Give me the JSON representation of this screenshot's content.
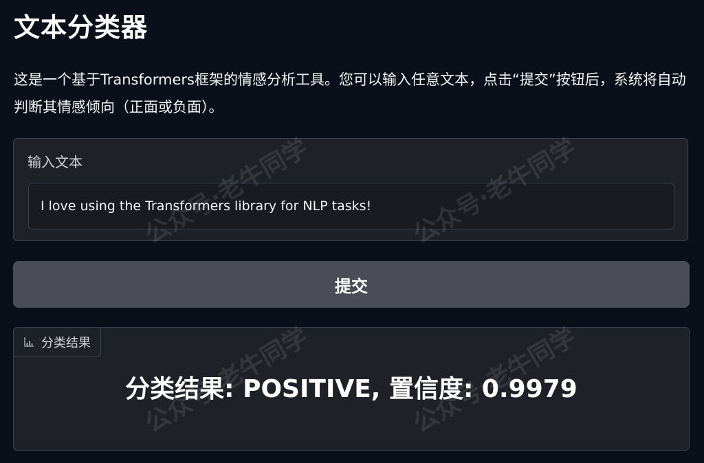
{
  "page": {
    "title": "文本分类器",
    "description": "这是一个基于Transformers框架的情感分析工具。您可以输入任意文本，点击“提交”按钮后，系统将自动判断其情感倾向（正面或负面）。"
  },
  "input": {
    "label": "输入文本",
    "value": "I love using the Transformers library for NLP tasks!"
  },
  "submit": {
    "label": "提交"
  },
  "output": {
    "label": "分类结果",
    "icon": "bar-chart-icon",
    "result": "分类结果: POSITIVE, 置信度: 0.9979"
  },
  "watermark": {
    "text": "公众号·老牛同学"
  },
  "colors": {
    "background": "#0b0f19",
    "panel": "#1f2128",
    "border": "#374151",
    "button": "#4b4d56",
    "text": "#f3f4f6"
  }
}
